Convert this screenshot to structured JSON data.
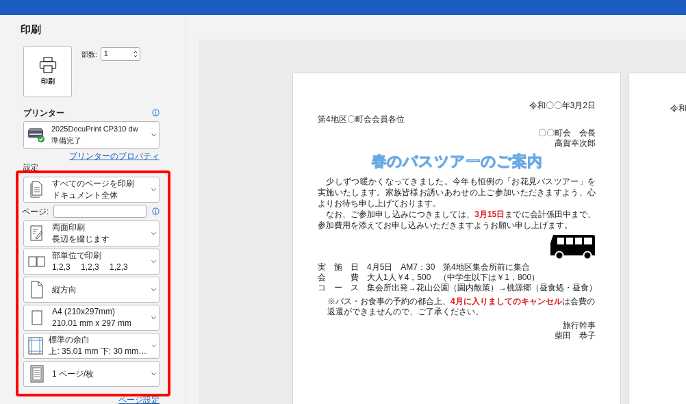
{
  "title": "印刷",
  "print_button": {
    "label": "印刷"
  },
  "copies": {
    "label": "部数:",
    "value": "1"
  },
  "printer": {
    "heading": "プリンター",
    "name": "2025DocuPrint CP310 dw",
    "status": "準備完了",
    "properties_link": "プリンターのプロパティ"
  },
  "settings": {
    "heading": "設定",
    "items": [
      {
        "kind": "dropdown",
        "line1": "すべてのページを印刷",
        "line2": "ドキュメント全体"
      },
      {
        "kind": "pages",
        "label": "ページ:"
      },
      {
        "kind": "dropdown",
        "line1": "両面印刷",
        "line2": "長辺を綴じます"
      },
      {
        "kind": "dropdown",
        "line1": "部単位で印刷",
        "line2": "1,2,3　 1,2,3　 1,2,3"
      },
      {
        "kind": "dropdown",
        "line1": "縦方向"
      },
      {
        "kind": "dropdown",
        "line1": "A4 (210x297mm)",
        "line2": "210.01 mm x 297 mm"
      },
      {
        "kind": "dropdown",
        "line1": "標準の余白",
        "line2": "上: 35.01 mm 下: 30 mm…"
      },
      {
        "kind": "dropdown",
        "line1": "1 ページ/枚"
      }
    ],
    "page_setup_link": "ページ設定"
  },
  "preview": {
    "pages": [
      {
        "lines": [
          {
            "kind": "right",
            "text": "令和〇〇年3月2日"
          },
          {
            "kind": "left",
            "text": "第4地区〇町会会員各位"
          },
          {
            "kind": "right",
            "text": "〇〇町会　会長"
          },
          {
            "kind": "right",
            "text": "高賀幸次郎"
          },
          {
            "kind": "title",
            "text": "春のバスツアーのご案内"
          },
          {
            "kind": "body",
            "text": "　少しずつ暖かくなってきました。今年も恒例の「お花見バスツアー」を実施いたします。家族皆様お誘いあわせの上ご参加いただきますよう、心よりお待ち申し上げております。"
          },
          {
            "kind": "body",
            "text": "　なお、ご参加申し込みにつきましては、**3月15日**までに会計係田中まで、参加費用を添えてお申し込みいただきますようお願い申し上げます。"
          },
          {
            "kind": "bus"
          },
          {
            "kind": "item",
            "text": "実　施　日　4月5日　AM7：30　第4地区集会所前に集合"
          },
          {
            "kind": "item",
            "text": "会　　　費　大人1人￥4，500　（中学生以下は￥1，800）"
          },
          {
            "kind": "item",
            "text": "コ　ー　ス　集会所出発→花山公園（園内散策）→桃源郷（昼食処・昼食）"
          },
          {
            "kind": "note",
            "text": "※バス・お食事の予約の都合上、**4月に入りましてのキャンセル**は会費の返還ができませんので、ご了承ください。"
          },
          {
            "kind": "right",
            "text": "旅行幹事"
          },
          {
            "kind": "right",
            "text": "柴田　恭子"
          }
        ]
      },
      {
        "lines": [
          {
            "kind": "right",
            "text": "令和"
          }
        ]
      }
    ]
  }
}
